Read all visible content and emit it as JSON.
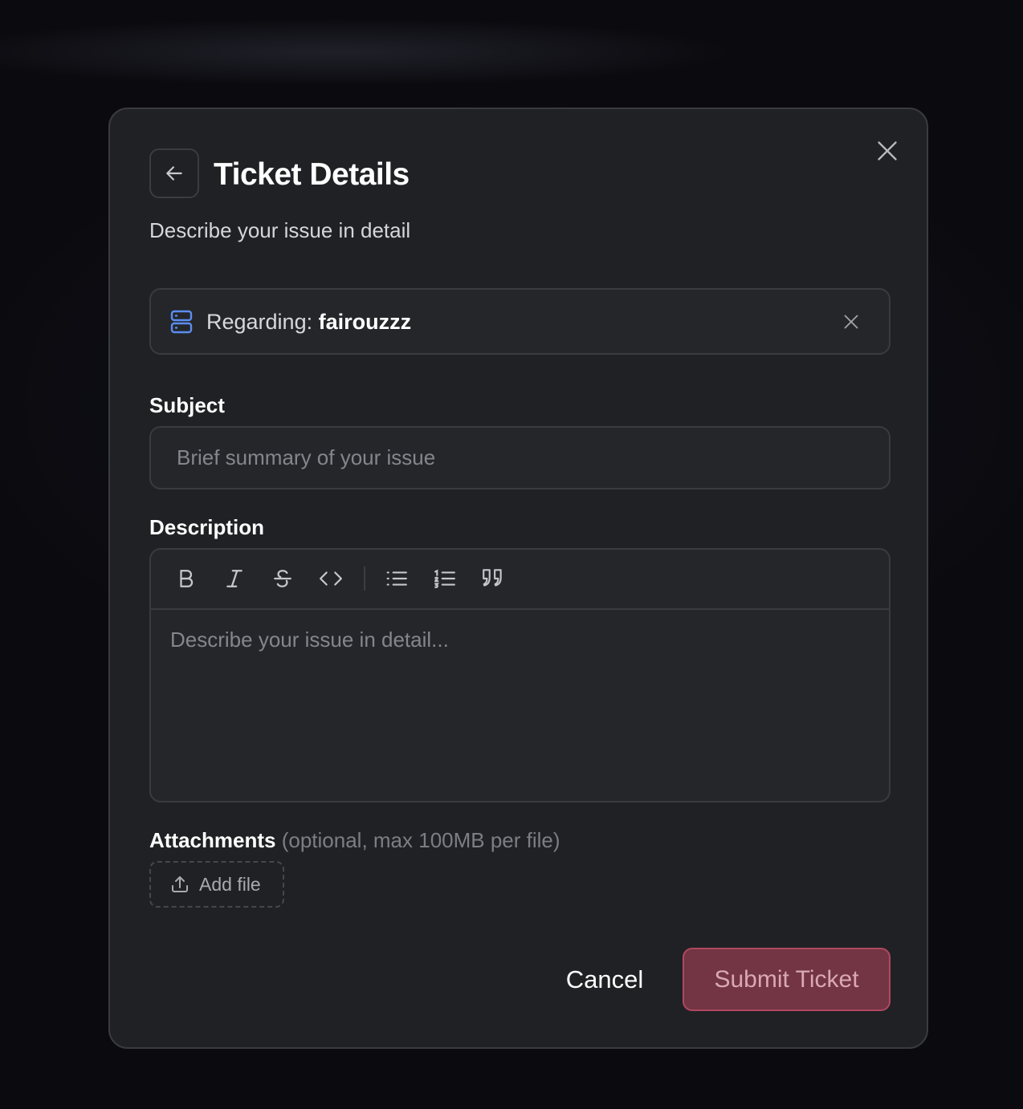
{
  "dialog": {
    "title": "Ticket Details",
    "subtitle": "Describe your issue in detail",
    "back_icon": "arrow-left-icon",
    "close_icon": "close-icon"
  },
  "regarding": {
    "prefix": "Regarding:",
    "value": "fairouzzz",
    "icon": "server-icon",
    "icon_color": "#5b8def",
    "clear_icon": "close-icon"
  },
  "subject": {
    "label": "Subject",
    "value": "",
    "placeholder": "Brief summary of your issue"
  },
  "description": {
    "label": "Description",
    "placeholder": "Describe your issue in detail...",
    "toolbar": [
      "bold-icon",
      "italic-icon",
      "strikethrough-icon",
      "code-icon",
      "bullet-list-icon",
      "ordered-list-icon",
      "quote-icon"
    ]
  },
  "attachments": {
    "label": "Attachments",
    "hint": "(optional, max 100MB per file)",
    "add_label": "Add file",
    "add_icon": "upload-icon"
  },
  "actions": {
    "cancel_label": "Cancel",
    "submit_label": "Submit Ticket",
    "submit_color": "#733443"
  }
}
